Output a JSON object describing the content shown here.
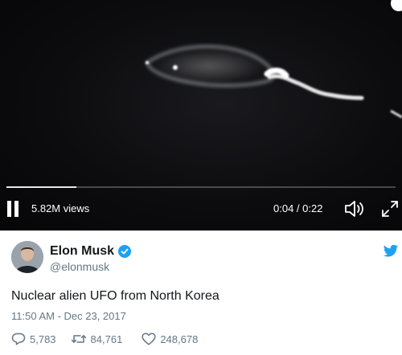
{
  "video": {
    "views": "5.82M views",
    "time": "0:04 / 0:22",
    "progress": 0.18
  },
  "controls": {
    "pause_icon": "pause-icon",
    "volume_icon": "volume-icon",
    "fullscreen_icon": "fullscreen-icon"
  },
  "tweet": {
    "author_name": "Elon Musk",
    "handle": "@elonmusk",
    "text": "Nuclear alien UFO from North Korea",
    "timestamp": "11:50 AM - Dec 23, 2017",
    "replies": "5,783",
    "retweets": "84,761",
    "likes": "248,678"
  },
  "colors": {
    "verified": "#1da1f2",
    "twitter_blue": "#1da1f2",
    "secondary_text": "#657786",
    "primary_text": "#14171a"
  }
}
